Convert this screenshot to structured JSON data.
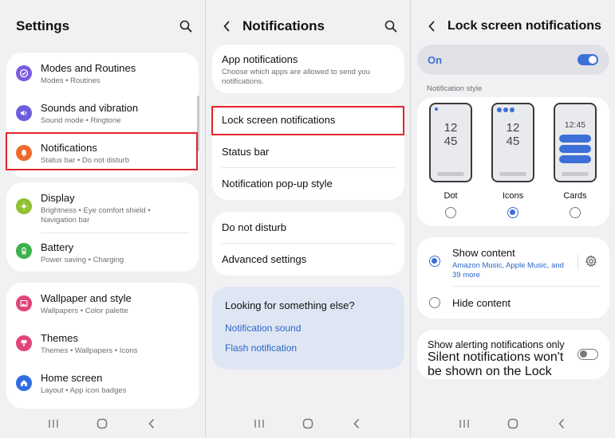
{
  "colors": {
    "accent": "#3c6fd8",
    "link": "#2a65c6",
    "highlight": "#e1242b"
  },
  "settings": {
    "title": "Settings",
    "groups": [
      [
        {
          "label": "Modes and Routines",
          "sub": "Modes  •  Routines",
          "icon": "check-circle-icon",
          "color": "#7c5ce0"
        },
        {
          "label": "Sounds and vibration",
          "sub": "Sound mode  •  Ringtone",
          "icon": "speaker-icon",
          "color": "#6f5de0"
        },
        {
          "label": "Notifications",
          "sub": "Status bar  •  Do not disturb",
          "icon": "bell-icon",
          "color": "#ec6a2b"
        }
      ],
      [
        {
          "label": "Display",
          "sub": "Brightness  •  Eye comfort shield  •  Navigation bar",
          "icon": "sun-icon",
          "color": "#8fc12e"
        },
        {
          "label": "Battery",
          "sub": "Power saving  •  Charging",
          "icon": "battery-icon",
          "color": "#3bb24a"
        }
      ],
      [
        {
          "label": "Wallpaper and style",
          "sub": "Wallpapers  •  Color palette",
          "icon": "image-icon",
          "color": "#e0447a"
        },
        {
          "label": "Themes",
          "sub": "Themes  •  Wallpapers  •  Icons",
          "icon": "brush-icon",
          "color": "#e0447a"
        },
        {
          "label": "Home screen",
          "sub": "Layout  •  App icon badges",
          "icon": "home-icon",
          "color": "#2f6ee0"
        }
      ]
    ]
  },
  "notifications": {
    "title": "Notifications",
    "app_notifications": {
      "label": "App notifications",
      "sub": "Choose which apps are allowed to send you notifications."
    },
    "group2": [
      "Lock screen notifications",
      "Status bar",
      "Notification pop-up style"
    ],
    "group3": [
      "Do not disturb",
      "Advanced settings"
    ],
    "looking": {
      "title": "Looking for something else?",
      "links": [
        "Notification sound",
        "Flash notification"
      ]
    }
  },
  "lock": {
    "title": "Lock screen notifications",
    "on_label": "On",
    "style_label": "Notification style",
    "clock_a": "12",
    "clock_b": "45",
    "clock_inline": "12:45",
    "styles": [
      {
        "label": "Dot",
        "selected": false
      },
      {
        "label": "Icons",
        "selected": true
      },
      {
        "label": "Cards",
        "selected": false
      }
    ],
    "show_content": {
      "label": "Show content",
      "sub": "Amazon Music, Apple Music, and 39 more"
    },
    "hide_content": {
      "label": "Hide content"
    },
    "alerting": {
      "label": "Show alerting notifications only",
      "sub": "Silent notifications won't be shown on the Lock screen.",
      "on": false
    }
  }
}
